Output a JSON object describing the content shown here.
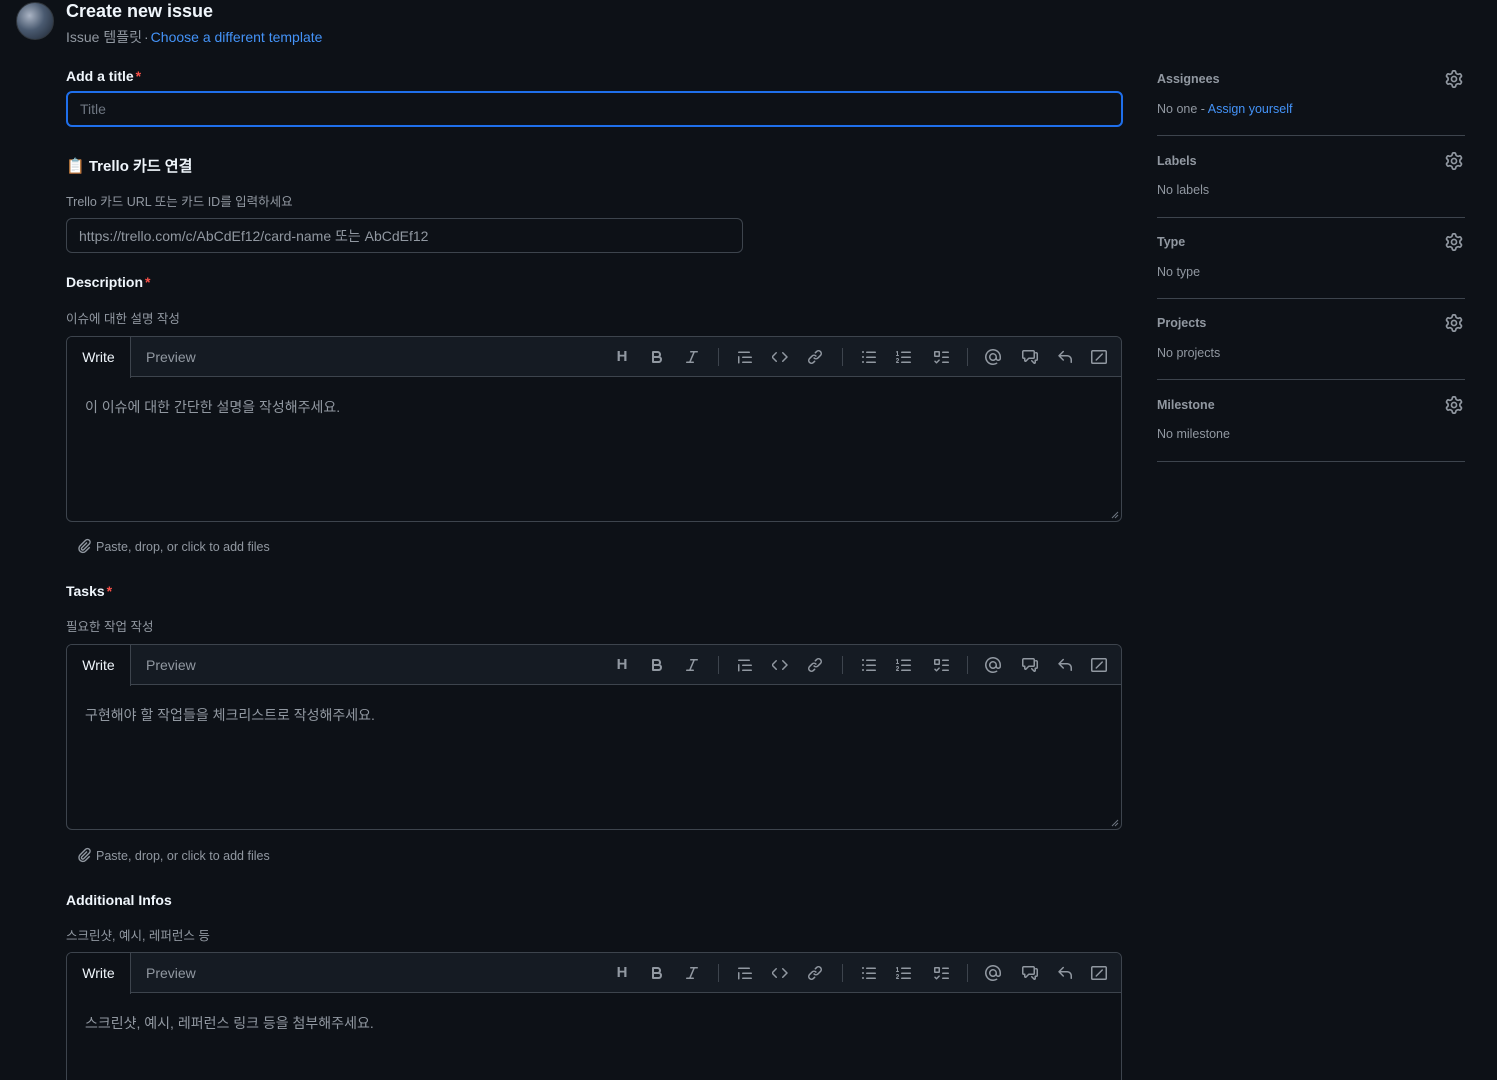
{
  "header": {
    "title": "Create new issue",
    "template_name": "Issue 템플릿",
    "separator": "·",
    "choose_template_link": "Choose a different template"
  },
  "form": {
    "title_field": {
      "label": "Add a title",
      "required_mark": "*",
      "placeholder": "Title",
      "value": ""
    },
    "trello": {
      "heading": "📋 Trello 카드 연결",
      "hint": "Trello 카드 URL 또는 카드 ID를 입력하세요",
      "placeholder": "https://trello.com/c/AbCdEf12/card-name 또는 AbCdEf12"
    },
    "description": {
      "label": "Description",
      "required_mark": "*",
      "hint": "이슈에 대한 설명 작성",
      "placeholder": "이 이슈에 대한 간단한 설명을 작성해주세요."
    },
    "tasks": {
      "label": "Tasks",
      "required_mark": "*",
      "hint": "필요한 작업 작성",
      "placeholder": "구현해야 할 작업들을 체크리스트로 작성해주세요."
    },
    "additional": {
      "label": "Additional Infos",
      "hint": "스크린샷, 예시, 레퍼런스 등",
      "placeholder": "스크린샷, 예시, 레퍼런스 링크 등을 첨부해주세요."
    }
  },
  "editor": {
    "write_tab": "Write",
    "preview_tab": "Preview",
    "heading_tool": "H",
    "attach_text": "Paste, drop, or click to add files",
    "toolbar_icons": [
      "heading-icon",
      "bold-icon",
      "italic-icon",
      "quote-icon",
      "code-icon",
      "link-icon",
      "bulleted-list-icon",
      "numbered-list-icon",
      "task-list-icon",
      "mention-icon",
      "cross-reference-icon",
      "saved-replies-icon",
      "slash-commands-icon"
    ]
  },
  "sidebar": {
    "assignees": {
      "title": "Assignees",
      "value": "No one",
      "separator": " - ",
      "action": "Assign yourself"
    },
    "labels": {
      "title": "Labels",
      "value": "No labels"
    },
    "type": {
      "title": "Type",
      "value": "No type"
    },
    "projects": {
      "title": "Projects",
      "value": "No projects"
    },
    "milestone": {
      "title": "Milestone",
      "value": "No milestone"
    }
  },
  "colors": {
    "background": "#0d1117",
    "accent_link": "#4493f8",
    "focus_border": "#1f6feb",
    "required": "#f85149",
    "muted_text": "#9198a1"
  }
}
